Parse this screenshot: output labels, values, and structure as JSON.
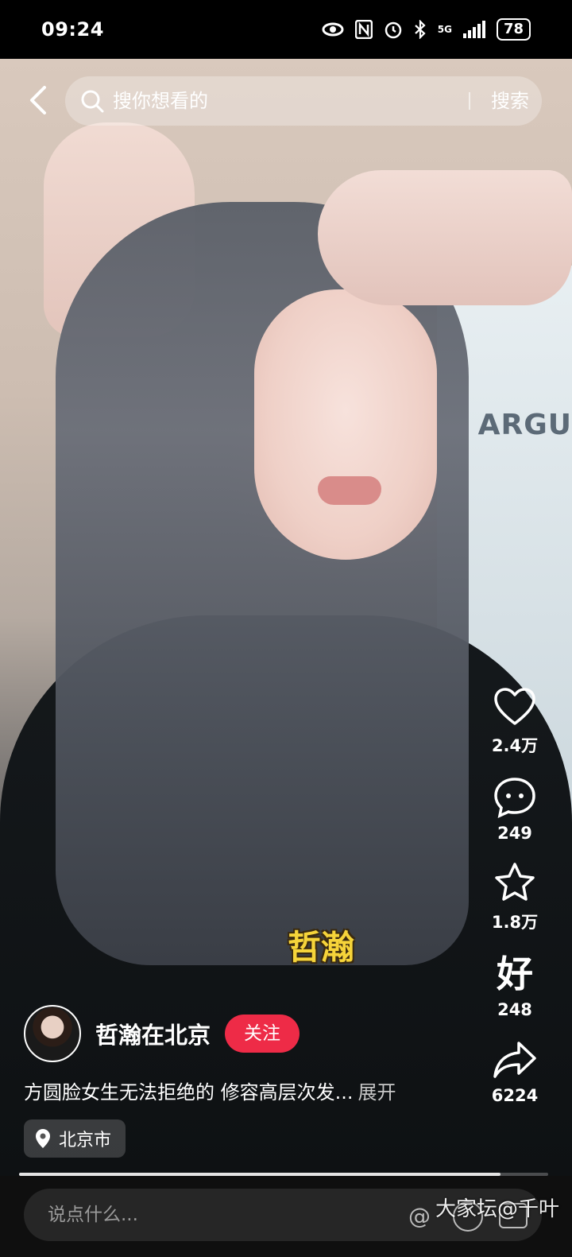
{
  "status_bar": {
    "time": "09:24",
    "network": "5G",
    "battery": "78"
  },
  "search": {
    "placeholder": "搜你想看的",
    "button_label": "搜索"
  },
  "video": {
    "caption": "哲瀚",
    "shirt_text": "ARGU"
  },
  "actions": {
    "like_count": "2.4万",
    "comment_count": "249",
    "collect_count": "1.8万",
    "good_label": "好",
    "good_count": "248",
    "share_count": "6224"
  },
  "author": {
    "name": "哲瀚在北京",
    "follow_label": "关注"
  },
  "post": {
    "description": "方圆脸女生无法拒绝的 修容高层次发...",
    "expand_label": "展开",
    "location": "北京市"
  },
  "progress": 0.91,
  "comment": {
    "placeholder": "说点什么..."
  },
  "watermark": "大家坛@千叶",
  "colors": {
    "follow": "#ee2b47",
    "caption": "#f6d43a",
    "background": "#000000"
  }
}
